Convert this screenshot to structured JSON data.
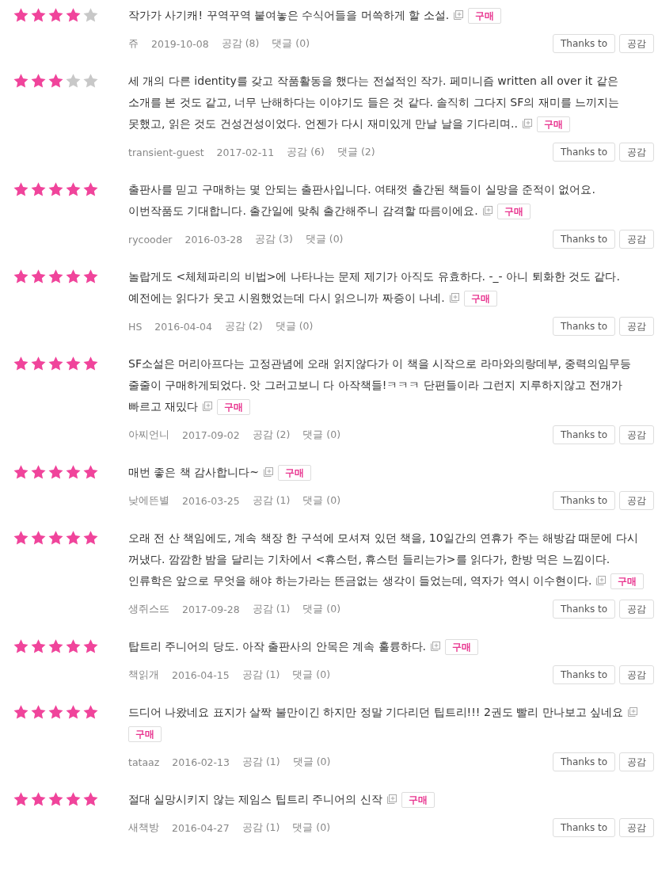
{
  "reviews": [
    {
      "stars": 4,
      "text": "작가가 사기캐! 꾸역꾸역 붙여놓은 수식어들을 머쓱하게 할 소설.",
      "badge": "구매",
      "author": "쥬",
      "date": "2019-10-08",
      "likes": "공감 (8)",
      "comments": "댓글 (0)",
      "buttons": [
        "Thanks to",
        "공감"
      ]
    },
    {
      "stars": 3,
      "text": "세 개의 다른 identity를 갖고 작품활동을 했다는 전설적인 작가. 페미니즘 written all over it 같은 소개를 본 것도 같고, 너무 난해하다는 이야기도 들은 것 같다. 솔직히 그다지 SF의 재미를 느끼지는 못했고, 읽은 것도 건성건성이었다. 언젠가 다시 재미있게 만날 날을 기다리며..",
      "badge": "구매",
      "author": "transient-guest",
      "date": "2017-02-11",
      "likes": "공감 (6)",
      "comments": "댓글 (2)",
      "buttons": [
        "Thanks to",
        "공감"
      ]
    },
    {
      "stars": 5,
      "text": "출판사를 믿고 구매하는 몇 안되는 출판사입니다. 여태껏 출간된 책들이 실망을 준적이 없어요. 이번작품도 기대합니다. 출간일에 맞춰 출간해주니 감격할 따름이에요.",
      "badge": "구매",
      "author": "rycooder",
      "date": "2016-03-28",
      "likes": "공감 (3)",
      "comments": "댓글 (0)",
      "buttons": [
        "Thanks to",
        "공감"
      ]
    },
    {
      "stars": 5,
      "text": "놀랍게도 <체체파리의 비법>에 나타나는 문제 제기가 아직도 유효하다. -_- 아니 퇴화한 것도 같다. 예전에는 읽다가 웃고 시원했었는데 다시 읽으니까 짜증이 나네.",
      "badge": "구매",
      "author": "HS",
      "date": "2016-04-04",
      "likes": "공감 (2)",
      "comments": "댓글 (0)",
      "buttons": [
        "Thanks to",
        "공감"
      ]
    },
    {
      "stars": 5,
      "text": "SF소설은 머리아프다는 고정관념에 오래 읽지않다가 이 책을 시작으로 라마와의랑데부, 중력의임무등 줄줄이 구매하게되었다. 앗 그러고보니 다 아작책들!ㅋㅋㅋ 단편들이라 그런지 지루하지않고 전개가 빠르고 재밌다",
      "badge": "구매",
      "author": "아찌언니",
      "date": "2017-09-02",
      "likes": "공감 (2)",
      "comments": "댓글 (0)",
      "buttons": [
        "Thanks to",
        "공감"
      ]
    },
    {
      "stars": 5,
      "text": "매번 좋은 책 감사합니다~",
      "badge": "구매",
      "author": "낮에뜬별",
      "date": "2016-03-25",
      "likes": "공감 (1)",
      "comments": "댓글 (0)",
      "buttons": [
        "Thanks to",
        "공감"
      ]
    },
    {
      "stars": 5,
      "text": "오래 전 산 책임에도, 계속 책장 한 구석에 모셔져 있던 책을, 10일간의 연휴가 주는 해방감 때문에 다시 꺼냈다. 깜깜한 밤을 달리는 기차에서 <휴스턴, 휴스턴 들리는가>를 읽다가, 한방 먹은 느낌이다. 인류학은 앞으로 무엇을 해야 하는가라는 뜬금없는 생각이 들었는데, 역자가 역시 이수현이다.",
      "badge": "구매",
      "author": "생쥐스뜨",
      "date": "2017-09-28",
      "likes": "공감 (1)",
      "comments": "댓글 (0)",
      "buttons": [
        "Thanks to",
        "공감"
      ]
    },
    {
      "stars": 5,
      "text": "탑트리 주니어의 당도. 아작 출판사의 안목은 계속 훌륭하다.",
      "badge": "구매",
      "author": "책읽개",
      "date": "2016-04-15",
      "likes": "공감 (1)",
      "comments": "댓글 (0)",
      "buttons": [
        "Thanks to",
        "공감"
      ]
    },
    {
      "stars": 5,
      "text": "드디어 나왔네요 표지가 살짝 불만이긴 하지만 정말 기다리던 팁트리!!! 2권도 빨리 만나보고 싶네요",
      "badge": "구매",
      "author": "tataaz",
      "date": "2016-02-13",
      "likes": "공감 (1)",
      "comments": "댓글 (0)",
      "buttons": [
        "Thanks to",
        "공감"
      ]
    },
    {
      "stars": 5,
      "text": "절대 실망시키지 않는 제임스 팁트리 주니어의 신작",
      "badge": "구매",
      "author": "새책방",
      "date": "2016-04-27",
      "likes": "공감 (1)",
      "comments": "댓글 (0)",
      "buttons": [
        "Thanks to",
        "공감"
      ]
    }
  ]
}
